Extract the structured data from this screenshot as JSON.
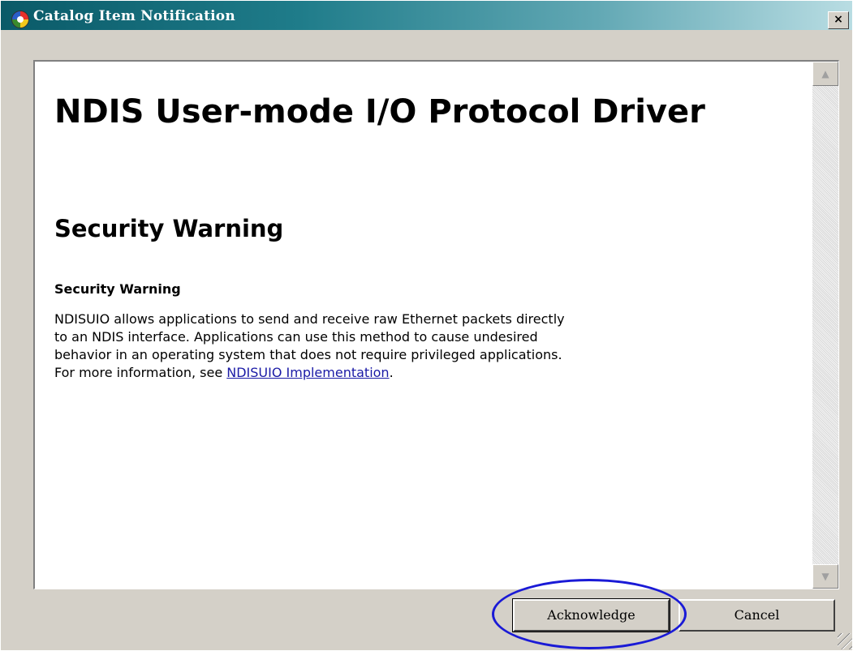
{
  "window": {
    "title": "Catalog Item Notification",
    "close_label": "×"
  },
  "document": {
    "heading": "NDIS User-mode I/O Protocol Driver",
    "subheading": "Security Warning",
    "section_title": "Security Warning",
    "body_lines": [
      "NDISUIO allows applications to send and receive raw Ethernet packets directly",
      "to an NDIS interface. Applications can use this method to cause undesired",
      "behavior in an operating system that does not require privileged applications."
    ],
    "more_info_prefix": "For more information, see ",
    "more_info_link": "NDISUIO Implementation",
    "more_info_suffix": "."
  },
  "scrollbar": {
    "up_arrow": "▲",
    "down_arrow": "▼"
  },
  "buttons": {
    "acknowledge": "Acknowledge",
    "cancel": "Cancel"
  },
  "icons": {
    "app": "catalog-app-icon",
    "close": "close-icon"
  },
  "colors": {
    "titlebar_start": "#0a5a68",
    "titlebar_end": "#b9dde3",
    "highlight": "#1a1ad6",
    "link": "#1a1aa6"
  }
}
